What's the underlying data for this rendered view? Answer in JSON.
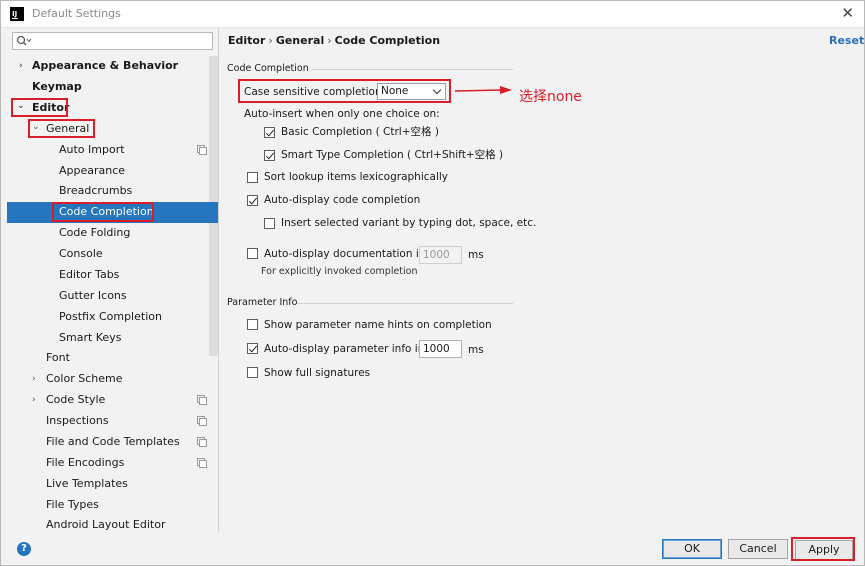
{
  "window": {
    "title": "Default Settings",
    "app_icon_text": "IJ"
  },
  "search": {
    "value": "",
    "placeholder": ""
  },
  "tree": [
    {
      "label": "Appearance & Behavior",
      "arrow": "›"
    },
    {
      "label": "Keymap"
    },
    {
      "label": "Editor",
      "arrow": "⌄"
    },
    {
      "label": "General",
      "arrow": "⌄"
    },
    {
      "label": "Auto Import"
    },
    {
      "label": "Appearance"
    },
    {
      "label": "Breadcrumbs"
    },
    {
      "label": "Code Completion"
    },
    {
      "label": "Code Folding"
    },
    {
      "label": "Console"
    },
    {
      "label": "Editor Tabs"
    },
    {
      "label": "Gutter Icons"
    },
    {
      "label": "Postfix Completion"
    },
    {
      "label": "Smart Keys"
    },
    {
      "label": "Font"
    },
    {
      "label": "Color Scheme",
      "arrow": "›"
    },
    {
      "label": "Code Style",
      "arrow": "›"
    },
    {
      "label": "Inspections"
    },
    {
      "label": "File and Code Templates"
    },
    {
      "label": "File Encodings"
    },
    {
      "label": "Live Templates"
    },
    {
      "label": "File Types"
    },
    {
      "label": "Android Layout Editor"
    }
  ],
  "breadcrumb": {
    "part1": "Editor",
    "sep": "›",
    "part2": "General",
    "part3": "Code Completion"
  },
  "reset_label": "Reset",
  "code_completion": {
    "section_title": "Code Completion",
    "case_sensitive_label": "Case sensitive completion:",
    "case_sensitive_value": "None",
    "auto_insert_label": "Auto-insert when only one choice on:",
    "basic_completion": {
      "label": "Basic Completion ( Ctrl+空格 )",
      "checked": true
    },
    "smart_type_completion": {
      "label": "Smart Type Completion ( Ctrl+Shift+空格 )",
      "checked": true
    },
    "sort_lexicographically": {
      "label": "Sort lookup items lexicographically",
      "checked": false
    },
    "auto_display_completion": {
      "label": "Auto-display code completion",
      "checked": true
    },
    "insert_variant": {
      "label": "Insert selected variant by typing dot, space, etc.",
      "checked": false
    },
    "auto_display_doc": {
      "label": "Auto-display documentation in",
      "checked": false,
      "value": "1000",
      "unit": "ms"
    },
    "explicit_note": "For explicitly invoked completion"
  },
  "parameter_info": {
    "section_title": "Parameter Info",
    "show_hints": {
      "label": "Show parameter name hints on completion",
      "checked": false
    },
    "auto_display_param": {
      "label": "Auto-display parameter info in",
      "checked": true,
      "value": "1000",
      "unit": "ms"
    },
    "show_full_signatures": {
      "label": "Show full signatures",
      "checked": false
    }
  },
  "annotation_text": "选择none",
  "buttons": {
    "ok": "OK",
    "cancel": "Cancel",
    "apply": "Apply",
    "help": "?"
  },
  "colors": {
    "accent": "#2675bf",
    "annotation_red": "#d71e2a",
    "link": "#2a6fc1"
  }
}
